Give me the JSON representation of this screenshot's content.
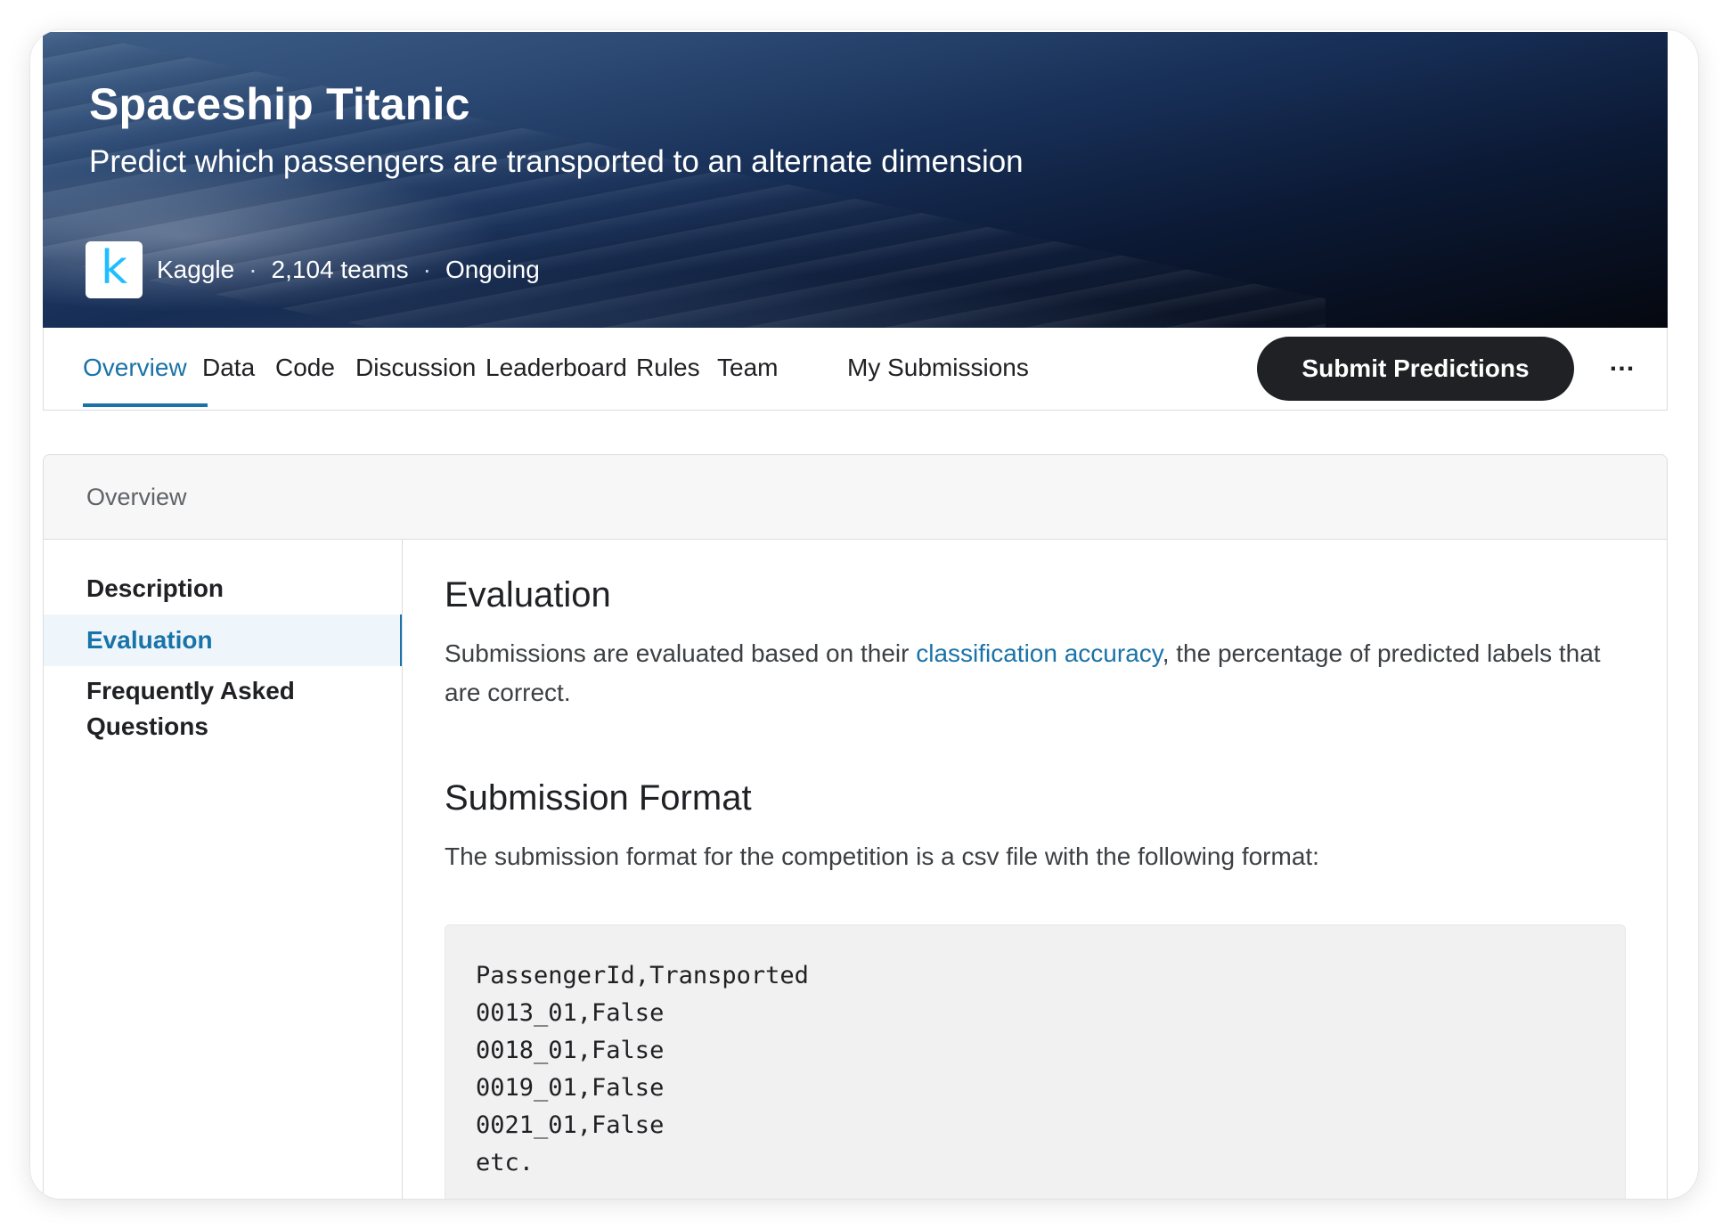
{
  "banner": {
    "title": "Spaceship Titanic",
    "subtitle": "Predict which passengers are transported to an alternate dimension",
    "host_logo_letter": "k",
    "host": "Kaggle",
    "separator": "·",
    "teams": "2,104 teams",
    "status": "Ongoing"
  },
  "tabs": [
    {
      "label": "Overview",
      "active": true
    },
    {
      "label": "Data"
    },
    {
      "label": "Code"
    },
    {
      "label": "Discussion"
    },
    {
      "label": "Leaderboard"
    },
    {
      "label": "Rules"
    },
    {
      "label": "Team"
    }
  ],
  "my_submissions": "My Submissions",
  "submit_button": "Submit Predictions",
  "more_glyph": "…",
  "card": {
    "header": "Overview",
    "sidenav": [
      {
        "label": "Description"
      },
      {
        "label": "Evaluation",
        "active": true
      },
      {
        "label": "Frequently Asked Questions"
      }
    ]
  },
  "content": {
    "evaluation_heading": "Evaluation",
    "evaluation_text_before": "Submissions are evaluated based on their ",
    "evaluation_link": "classification accuracy",
    "evaluation_text_after": ", the percentage of predicted labels that are correct.",
    "format_heading": "Submission Format",
    "format_text": "The submission format for the competition is a csv file with the following format:",
    "code": "PassengerId,Transported\n0013_01,False\n0018_01,False\n0019_01,False\n0021_01,False\netc."
  },
  "colors": {
    "accent": "#1a73a8",
    "button_bg": "#202124",
    "kaggle_blue": "#20beff"
  }
}
